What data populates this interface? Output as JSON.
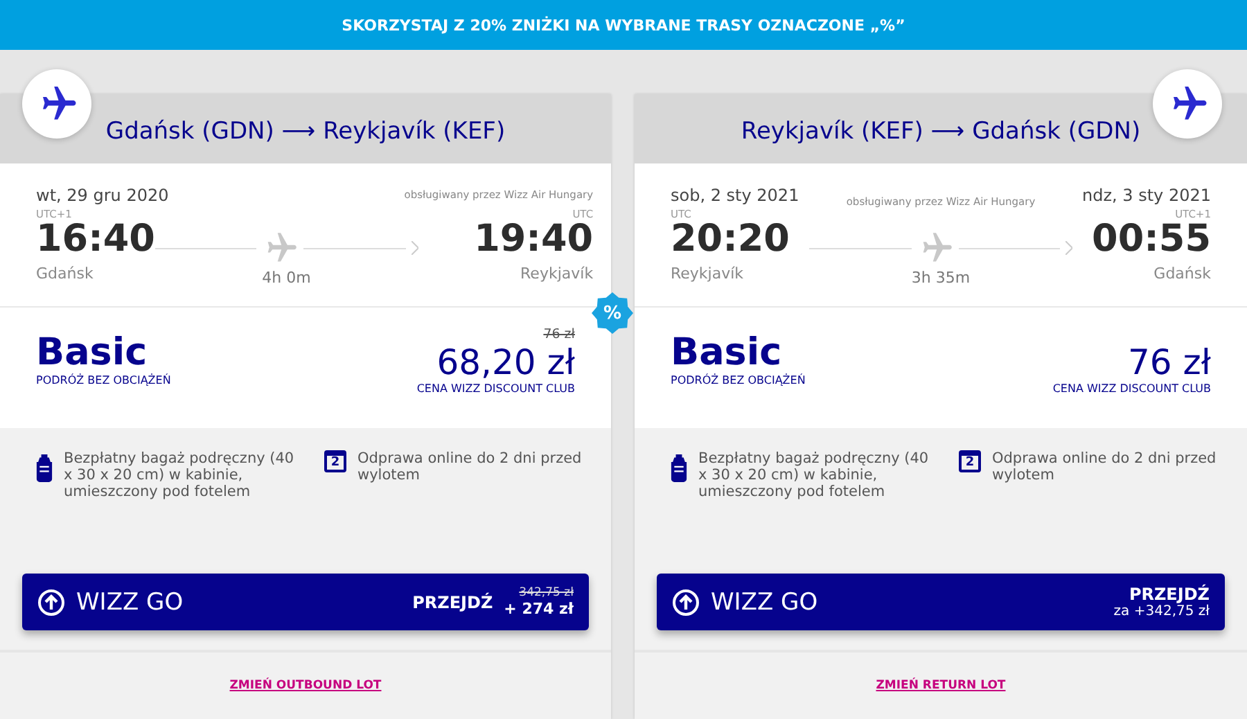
{
  "banner": "SKORZYSTAJ Z 20% ZNIŻKI NA WYBRANE TRASY OZNACZONE „%”",
  "flights": [
    {
      "title": "Gdańsk (GDN) ⟶ Reykjavík (KEF)",
      "dep_date": "wt, 29 gru 2020",
      "operator": "obsługiwany przez Wizz Air Hungary",
      "dep_tz": "UTC+1",
      "arr_tz": "UTC",
      "dep_time": "16:40",
      "arr_time": "19:40",
      "dep_city": "Gdańsk",
      "arr_city": "Reykjavík",
      "duration": "4h 0m",
      "fare": "Basic",
      "fare_note": "PODRÓŻ BEZ OBCIĄŻEŃ",
      "old_price": "76 zł",
      "price": "68,20 zł",
      "price_note": "CENA WIZZ DISCOUNT CLUB",
      "discount": "%",
      "features": [
        {
          "kind": "bag",
          "text": "Bezpłatny bagaż podręczny (40 x 30 x 20 cm) w kabinie, umieszczony pod fotelem"
        },
        {
          "kind": "calendar",
          "icon_text": "2",
          "text": "Odprawa online do 2 dni przed wylotem"
        }
      ],
      "upgrade": {
        "label": "WIZZ GO",
        "action": "PRZEJDŹ",
        "old_price": "342,75 zł",
        "price": "+ 274 zł"
      },
      "change_link": "ZMIEŃ OUTBOUND LOT"
    },
    {
      "title": "Reykjavík (KEF) ⟶ Gdańsk (GDN)",
      "dep_date": "sob, 2 sty 2021",
      "arr_date": "ndz, 3 sty 2021",
      "operator": "obsługiwany przez Wizz Air Hungary",
      "dep_tz": "UTC",
      "arr_tz": "UTC+1",
      "dep_time": "20:20",
      "arr_time": "00:55",
      "dep_city": "Reykjavík",
      "arr_city": "Gdańsk",
      "duration": "3h 35m",
      "fare": "Basic",
      "fare_note": "PODRÓŻ BEZ OBCIĄŻEŃ",
      "price": "76 zł",
      "price_note": "CENA WIZZ DISCOUNT CLUB",
      "features": [
        {
          "kind": "bag",
          "text": "Bezpłatny bagaż podręczny (40 x 30 x 20 cm) w kabinie, umieszczony pod fotelem"
        },
        {
          "kind": "calendar",
          "icon_text": "2",
          "text": "Odprawa online do 2 dni przed wylotem"
        }
      ],
      "upgrade": {
        "label": "WIZZ GO",
        "action": "PRZEJDŹ",
        "price": "za +342,75 zł"
      },
      "change_link": "ZMIEŃ RETURN LOT"
    }
  ]
}
